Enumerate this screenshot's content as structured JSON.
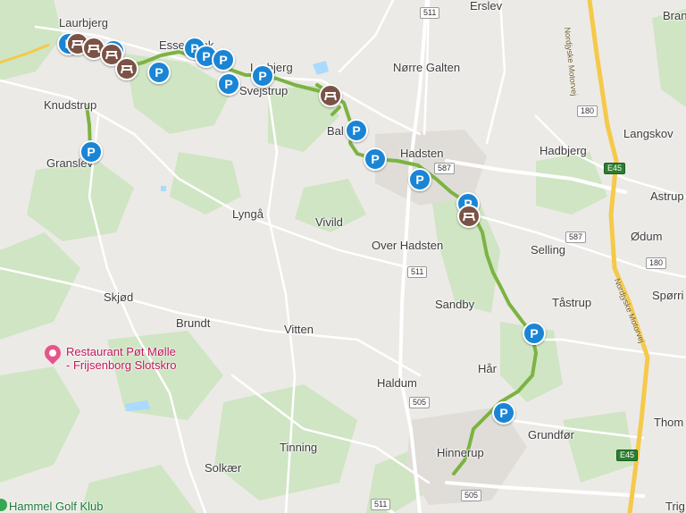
{
  "places": [
    {
      "key": "laurbjerg",
      "name": "Laurbjerg"
    },
    {
      "key": "erslev",
      "name": "Erslev"
    },
    {
      "key": "bran",
      "name": "Bran"
    },
    {
      "key": "essenbaek",
      "name": "Essenbæk"
    },
    {
      "key": "norre-galten",
      "name": "Nørre Galten"
    },
    {
      "key": "lerbjerg",
      "name": "Lerbjerg"
    },
    {
      "key": "svejstrup",
      "name": "Svejstrup"
    },
    {
      "key": "knudstrup",
      "name": "Knudstrup"
    },
    {
      "key": "ballum",
      "name": "Bal"
    },
    {
      "key": "langskov",
      "name": "Langskov"
    },
    {
      "key": "hadsten",
      "name": "Hadsten"
    },
    {
      "key": "hadbjerg",
      "name": "Hadbjerg"
    },
    {
      "key": "granslev",
      "name": "Granslev"
    },
    {
      "key": "astrup",
      "name": "Astrup"
    },
    {
      "key": "lynga",
      "name": "Lyngå"
    },
    {
      "key": "vivild",
      "name": "Vivild"
    },
    {
      "key": "odum",
      "name": "Ødum"
    },
    {
      "key": "selling",
      "name": "Selling"
    },
    {
      "key": "over-hadsten",
      "name": "Over Hadsten"
    },
    {
      "key": "sporring",
      "name": "Spørri"
    },
    {
      "key": "skjod",
      "name": "Skjød"
    },
    {
      "key": "sandby",
      "name": "Sandby"
    },
    {
      "key": "tastrup",
      "name": "Tåstrup"
    },
    {
      "key": "brundt",
      "name": "Brundt"
    },
    {
      "key": "vitten",
      "name": "Vitten"
    },
    {
      "key": "har",
      "name": "Hår"
    },
    {
      "key": "haldum",
      "name": "Haldum"
    },
    {
      "key": "thom",
      "name": "Thom"
    },
    {
      "key": "grundfor",
      "name": "Grundfør"
    },
    {
      "key": "tinning",
      "name": "Tinning"
    },
    {
      "key": "hinnerup",
      "name": "Hinnerup"
    },
    {
      "key": "solkaer",
      "name": "Solkær"
    },
    {
      "key": "trig",
      "name": "Trig"
    }
  ],
  "pois": {
    "restaurant_line1": "Restaurant Pøt Mølle",
    "restaurant_line2": "- Frijsenborg Slotskro",
    "golf": "Hammel Golf Klub"
  },
  "road_shields": {
    "r511_top": "511",
    "r180_a": "180",
    "r587_a": "587",
    "e45_a": "E45",
    "r587_b": "587",
    "r180_b": "180",
    "r511_mid": "511",
    "r505_a": "505",
    "e45_b": "E45",
    "r505_b": "505",
    "r511_bottom": "511"
  },
  "motorway_labels": {
    "top": "Nordjyske Motorvej",
    "mid": "Nordjyske Motorvej"
  },
  "markers": {
    "parking_label": "P",
    "parking_count": 14,
    "picnic_count": 6
  },
  "colors": {
    "route": "#7cb342",
    "parking": "#1a85d4",
    "picnic": "#7b5346",
    "motorway": "#f5c94a",
    "poi": "#c2185b",
    "forest": "#cfe5c4"
  }
}
